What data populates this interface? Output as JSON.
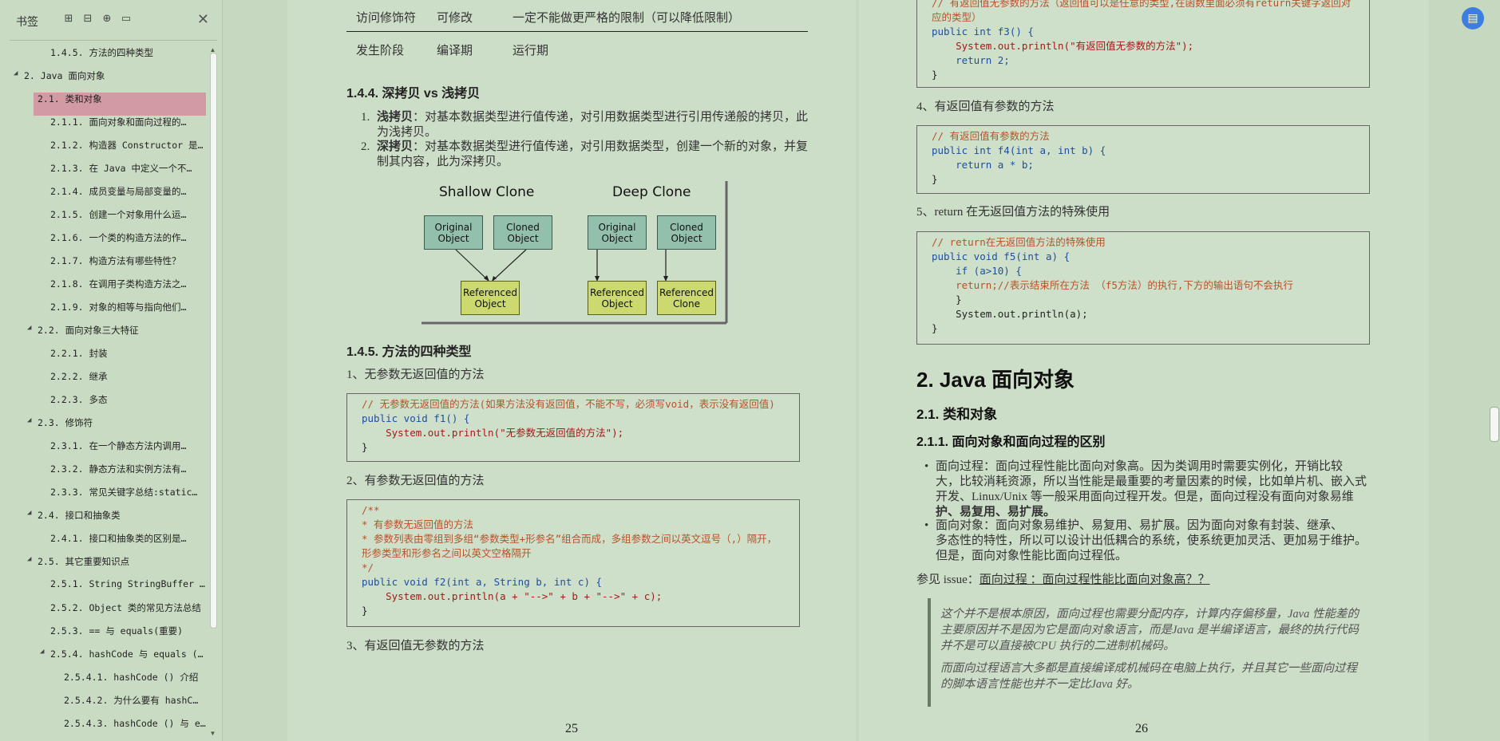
{
  "sidebar": {
    "title": "书签",
    "toc": [
      {
        "label": "1.4.5. 方法的四种类型",
        "level": 3,
        "arrow": ""
      },
      {
        "label": "2. Java 面向对象",
        "level": 1,
        "arrow": "◢"
      },
      {
        "label": "2.1. 类和对象",
        "level": 2,
        "arrow": "◢",
        "selected": true
      },
      {
        "label": "2.1.1. 面向对象和面向过程的…",
        "level": 3,
        "arrow": ""
      },
      {
        "label": "2.1.2. 构造器 Constructor 是…",
        "level": 3,
        "arrow": ""
      },
      {
        "label": "2.1.3. 在 Java 中定义一个不…",
        "level": 3,
        "arrow": ""
      },
      {
        "label": "2.1.4. 成员变量与局部变量的…",
        "level": 3,
        "arrow": ""
      },
      {
        "label": "2.1.5. 创建一个对象用什么运…",
        "level": 3,
        "arrow": ""
      },
      {
        "label": "2.1.6. 一个类的构造方法的作…",
        "level": 3,
        "arrow": ""
      },
      {
        "label": "2.1.7. 构造方法有哪些特性？",
        "level": 3,
        "arrow": ""
      },
      {
        "label": "2.1.8. 在调用子类构造方法之…",
        "level": 3,
        "arrow": ""
      },
      {
        "label": "2.1.9. 对象的相等与指向他们…",
        "level": 3,
        "arrow": ""
      },
      {
        "label": "2.2. 面向对象三大特征",
        "level": 2,
        "arrow": "◢"
      },
      {
        "label": "2.2.1. 封装",
        "level": 3,
        "arrow": ""
      },
      {
        "label": "2.2.2. 继承",
        "level": 3,
        "arrow": ""
      },
      {
        "label": "2.2.3. 多态",
        "level": 3,
        "arrow": ""
      },
      {
        "label": "2.3. 修饰符",
        "level": 2,
        "arrow": "◢"
      },
      {
        "label": "2.3.1. 在一个静态方法内调用…",
        "level": 3,
        "arrow": ""
      },
      {
        "label": "2.3.2. 静态方法和实例方法有…",
        "level": 3,
        "arrow": ""
      },
      {
        "label": "2.3.3. 常见关键字总结:static…",
        "level": 3,
        "arrow": ""
      },
      {
        "label": "2.4. 接口和抽象类",
        "level": 2,
        "arrow": "◢"
      },
      {
        "label": "2.4.1. 接口和抽象类的区别是…",
        "level": 3,
        "arrow": ""
      },
      {
        "label": "2.5. 其它重要知识点",
        "level": 2,
        "arrow": "◢"
      },
      {
        "label": "2.5.1. String StringBuffer …",
        "level": 3,
        "arrow": ""
      },
      {
        "label": "2.5.2. Object 类的常见方法总结",
        "level": 3,
        "arrow": ""
      },
      {
        "label": "2.5.3. == 与 equals(重要)",
        "level": 3,
        "arrow": ""
      },
      {
        "label": "2.5.4. hashCode 与 equals (…",
        "level": 3,
        "arrow": "◢"
      },
      {
        "label": "2.5.4.1. hashCode () 介绍",
        "level": 4,
        "arrow": ""
      },
      {
        "label": "2.5.4.2. 为什么要有 hashC…",
        "level": 4,
        "arrow": ""
      },
      {
        "label": "2.5.4.3. hashCode () 与 e…",
        "level": 4,
        "arrow": ""
      }
    ]
  },
  "left_page": {
    "table_rows": [
      [
        "访问修饰符",
        "可修改",
        "一定不能做更严格的限制（可以降低限制）"
      ],
      [
        "发生阶段",
        "编译期",
        "运行期"
      ]
    ],
    "h_deep": "1.4.4. 深拷贝 vs 浅拷贝",
    "li1_num": "1.",
    "li1_bold": "浅拷贝",
    "li1_text": "：对基本数据类型进行值传递，对引用数据类型进行引用传递般的拷贝，此",
    "li1_text2": "为浅拷贝。",
    "li2_num": "2.",
    "li2_bold": "深拷贝",
    "li2_text": "：对基本数据类型进行值传递，对引用数据类型，创建一个新的对象，并复",
    "li2_text2": "制其内容，此为深拷贝。",
    "diagram": {
      "shallow_title": "Shallow Clone",
      "deep_title": "Deep Clone",
      "original": "Original Object",
      "cloned": "Cloned Object",
      "referenced": "Referenced Object",
      "ref_clone": "Referenced Clone"
    },
    "h_methods": "1.4.5. 方法的四种类型",
    "m1": "1、无参数无返回值的方法",
    "code1_c": "// 无参数无返回值的方法(如果方法没有返回值，不能不写，必须写void，表示没有返回值)",
    "code1_l1": "public void f1() {",
    "code1_l2": "    System.out.println(\"无参数无返回值的方法\");",
    "code1_l3": "}",
    "m2": "2、有参数无返回值的方法",
    "code2_c1": "/**",
    "code2_c2": "* 有参数无返回值的方法",
    "code2_c3": "* 参数列表由零组到多组“参数类型+形参名”组合而成，多组参数之间以英文逗号（,）隔开，",
    "code2_c4": "形参类型和形参名之间以英文空格隔开",
    "code2_c5": "*/",
    "code2_l1": "public void f2(int a, String b, int c) {",
    "code2_l2": "    System.out.println(a + \"-->\" + b + \"-->\" + c);",
    "code2_l3": "}",
    "m3": "3、有返回值无参数的方法",
    "page_number": "25"
  },
  "right_page": {
    "code3_c1": "// 有返回值无参数的方法（返回值可以是任意的类型,在函数里面必须有return关键字返回对",
    "code3_c2": "应的类型）",
    "code3_l1": "public int f3() {",
    "code3_l2": "    System.out.println(\"有返回值无参数的方法\");",
    "code3_l3": "    return 2;",
    "code3_l4": "}",
    "m4": "4、有返回值有参数的方法",
    "code4_c": "// 有返回值有参数的方法",
    "code4_l1": "public int f4(int a, int b) {",
    "code4_l2": "    return a * b;",
    "code4_l3": "}",
    "m5": "5、return 在无返回值方法的特殊使用",
    "code5_c": "// return在无返回值方法的特殊使用",
    "code5_l1": "public void f5(int a) {",
    "code5_l2": "    if (a>10) {",
    "code5_l3": "    return;//表示结束所在方法 （f5方法）的执行,下方的输出语句不会执行",
    "code5_l4": "    }",
    "code5_l5": "    System.out.println(a);",
    "code5_l6": "}",
    "h1": "2. Java 面向对象",
    "h2": "2.1. 类和对象",
    "h3": "2.1.1. 面向对象和面向过程的区别",
    "b1_line1": "面向过程：面向过程性能比面向对象高。因为类调用时需要实例化，开销比较",
    "b1_line2": "大，比较消耗资源，所以当性能是最重要的考量因素的时候，比如单片机、嵌入式",
    "b1_line3": "开发、Linux/Unix 等一般采用面向过程开发。但是，面向过程没有面向对象易维",
    "b1_line4": "护、易复用、易扩展。",
    "b2_line1": "面向对象：面向对象易维护、易复用、易扩展。因为面向对象有封装、继承、",
    "b2_line2": "多态性的特性，所以可以设计出低耦合的系统，使系统更加灵活、更加易于维护。",
    "b2_line3": "但是，面向对象性能比面向过程低。",
    "issue_label": "参见 issue：",
    "issue_link": "面向过程 ：面向过程性能比面向对象高？？",
    "q1_l1": "这个并不是根本原因，面向过程也需要分配内存，计算内存偏移量，Java 性能差的",
    "q1_l2": "主要原因并不是因为它是面向对象语言，而是Java 是半编译语言，最终的执行代码",
    "q1_l3": "并不是可以直接被CPU 执行的二进制机械码。",
    "q2_l1": "而面向过程语言大多都是直接编译成机械码在电脑上执行，并且其它一些面向过程",
    "q2_l2": "的脚本语言性能也并不一定比Java 好。",
    "page_number": "26"
  }
}
